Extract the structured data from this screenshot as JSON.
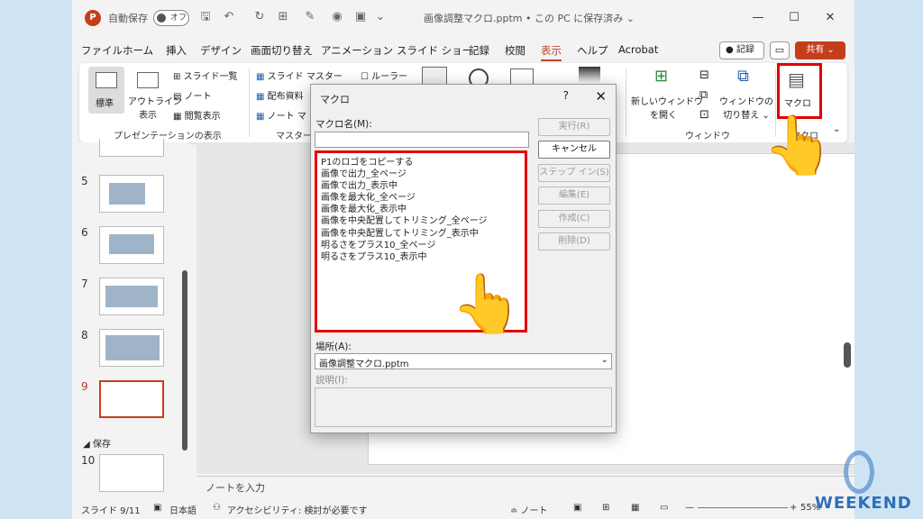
{
  "titlebar": {
    "autosave": "自動保存",
    "toggle": "オフ",
    "filename": "画像調整マクロ.pptm • この PC に保存済み ⌄"
  },
  "menu": [
    "ファイル",
    "ホーム",
    "挿入",
    "デザイン",
    "画面切り替え",
    "アニメーション",
    "スライド ショー",
    "記録",
    "校閲",
    "表示",
    "ヘルプ",
    "Acrobat"
  ],
  "menu_active": "表示",
  "topright": {
    "record": "● 記録",
    "share": "共有 ⌄"
  },
  "ribbon": {
    "normal": "標準",
    "outline": "アウトライン\n表示",
    "slide_list": "スライド一覧",
    "notes": "ノート",
    "reading": "閲覧表示",
    "slide_master": "スライド マスター",
    "handout": "配布資料",
    "notes_master": "ノート マ",
    "ruler": "ルーラー",
    "new_window": "新しいウィンドウ\nを開く",
    "switch_window": "ウィンドウの\n切り替え ⌄",
    "macro": "マクロ",
    "group_presentation": "プレゼンテーションの表示",
    "group_master": "マスター表",
    "group_window": "ウィンドウ",
    "group_macro": "マクロ"
  },
  "slides": [
    "5",
    "6",
    "7",
    "8",
    "9",
    "10"
  ],
  "section": "◢ 保存",
  "notes_placeholder": "ノートを入力",
  "status": {
    "slide": "スライド 9/11",
    "lang": "日本語",
    "access": "アクセシビリティ: 検討が必要です",
    "notes": "≐ ノート",
    "zoom": "55%"
  },
  "dialog": {
    "title": "マクロ",
    "help": "?",
    "name_label": "マクロ名(M):",
    "name_value": "",
    "macros": [
      "P1のロゴをコピーする",
      "画像で出力_全ページ",
      "画像で出力_表示中",
      "画像を最大化_全ページ",
      "画像を最大化_表示中",
      "画像を中央配置してトリミング_全ページ",
      "画像を中央配置してトリミング_表示中",
      "明るさをプラス10_全ページ",
      "明るさをプラス10_表示中"
    ],
    "buttons": {
      "run": "実行(R)",
      "cancel": "キャンセル",
      "step": "ステップ イン(S)",
      "edit": "編集(E)",
      "create": "作成(C)",
      "delete": "削除(D)"
    },
    "location_label": "場所(A):",
    "location_value": "画像調整マクロ.pptm",
    "desc_label": "説明(I):"
  },
  "watermark": "WEEKEND",
  "colors": {
    "accent": "#c43e1c",
    "highlight": "#e00000"
  }
}
